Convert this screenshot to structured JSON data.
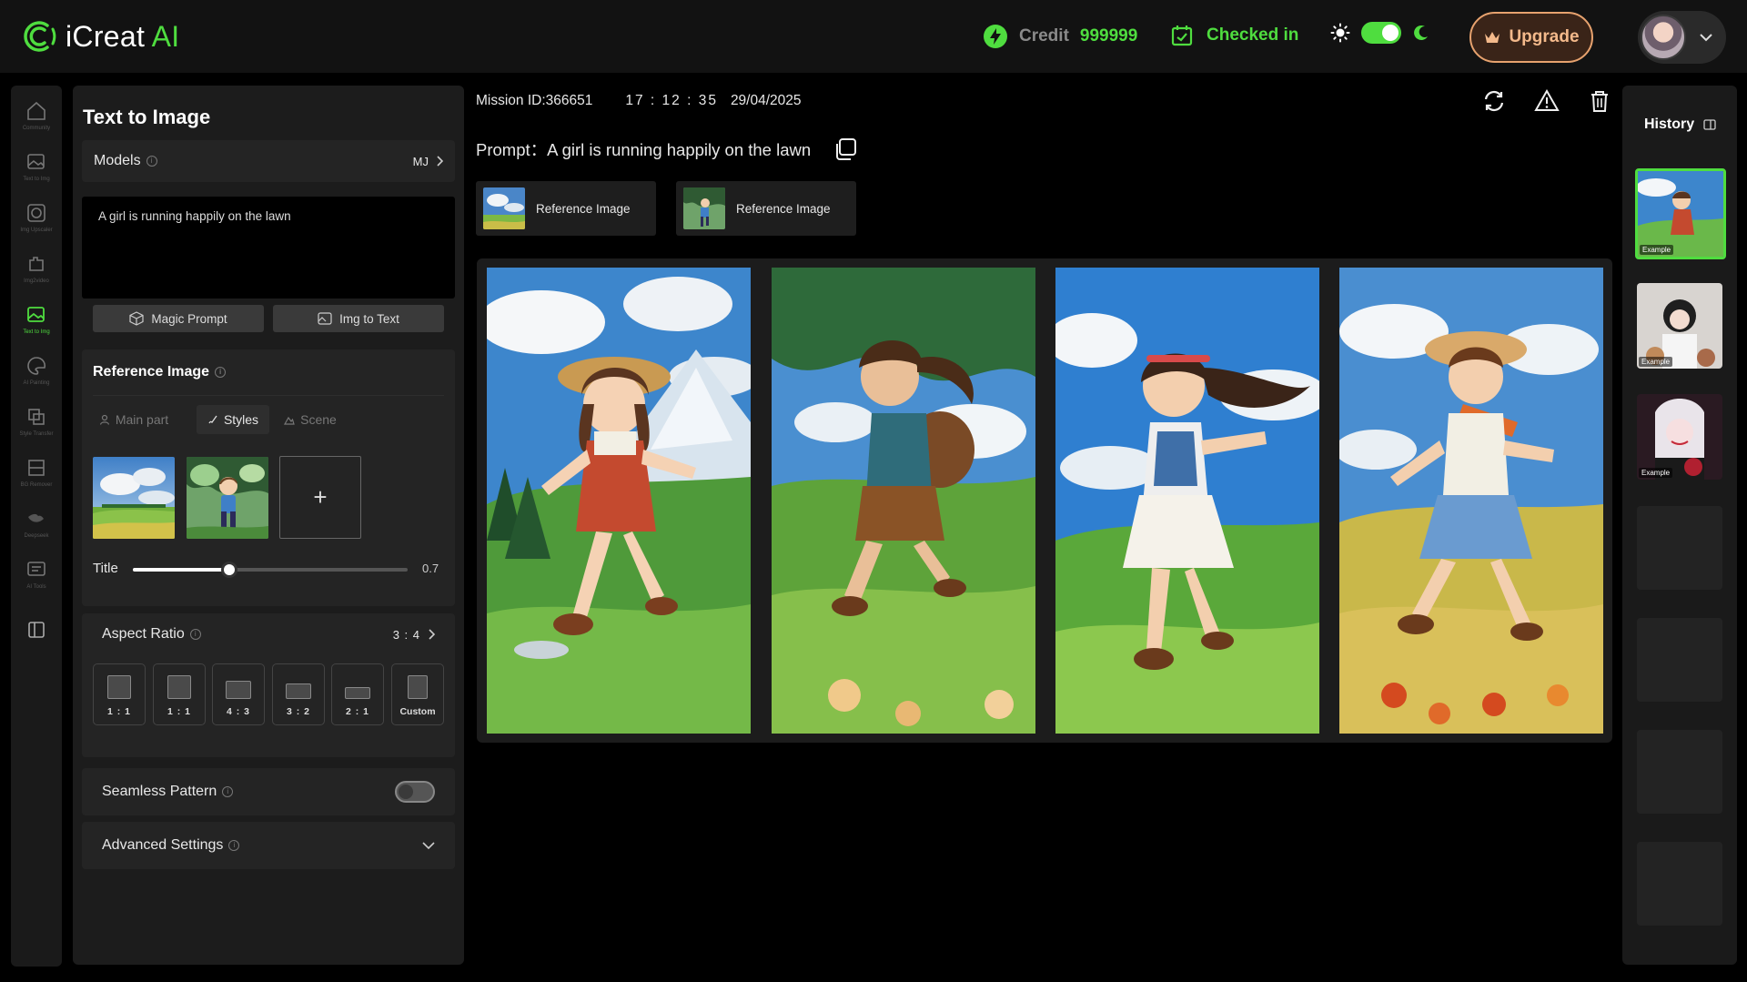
{
  "brand": {
    "name": "iCreat",
    "ai": "AI"
  },
  "header": {
    "credit_label": "Credit",
    "credit_value": "999999",
    "checkin_label": "Checked in",
    "upgrade_label": "Upgrade",
    "theme_toggle_on": true
  },
  "rail": {
    "items": [
      {
        "label": "Community",
        "icon": "home-icon"
      },
      {
        "label": "Text to Img",
        "icon": "image-edit-icon"
      },
      {
        "label": "Img Upscaler",
        "icon": "image-upscale-icon"
      },
      {
        "label": "Img2video",
        "icon": "puzzle-icon"
      },
      {
        "label": "Text to Img",
        "icon": "image-edit-icon",
        "active": true
      },
      {
        "label": "AI Painting",
        "icon": "palette-icon"
      },
      {
        "label": "Style Transfer",
        "icon": "layers-icon"
      },
      {
        "label": "BG Remover",
        "icon": "crop-icon"
      },
      {
        "label": "Deepseek",
        "icon": "deepseek-icon"
      },
      {
        "label": "AI Tools",
        "icon": "tools-icon"
      }
    ],
    "collapse_icon": "sidebar-collapse-icon"
  },
  "panel": {
    "title": "Text to Image",
    "models_label": "Models",
    "models_value": "MJ",
    "prompt_text": "A girl is running happily on the lawn",
    "magic_prompt_label": "Magic Prompt",
    "img_to_text_label": "Img to Text",
    "reference_title": "Reference Image",
    "tabs": [
      {
        "label": "Main part",
        "active": false
      },
      {
        "label": "Styles",
        "active": true
      },
      {
        "label": "Scene",
        "active": false
      }
    ],
    "add_symbol": "+",
    "slider_label": "Title",
    "slider_value": "0.7",
    "slider_fraction": 0.35,
    "aspect_label": "Aspect Ratio",
    "aspect_value": "3 : 4",
    "ratios": [
      "1 : 1",
      "1 : 1",
      "4 : 3",
      "3 : 2",
      "2 : 1",
      "Custom"
    ],
    "seamless_label": "Seamless Pattern",
    "seamless_on": false,
    "advanced_label": "Advanced Settings"
  },
  "main": {
    "mission_id": "Mission ID:366651",
    "time": "17 : 12 : 35",
    "date": "29/04/2025",
    "prompt_prefix": "Prompt：",
    "prompt_text": "A girl is running happily on the lawn",
    "ref_chips": [
      "Reference Image",
      "Reference Image"
    ]
  },
  "history": {
    "title": "History",
    "example_tag": "Example"
  },
  "colors": {
    "accent": "#4fdd3f",
    "upgrade": "#f3b98b",
    "background": "#000000",
    "panel": "#1c1c1c"
  }
}
